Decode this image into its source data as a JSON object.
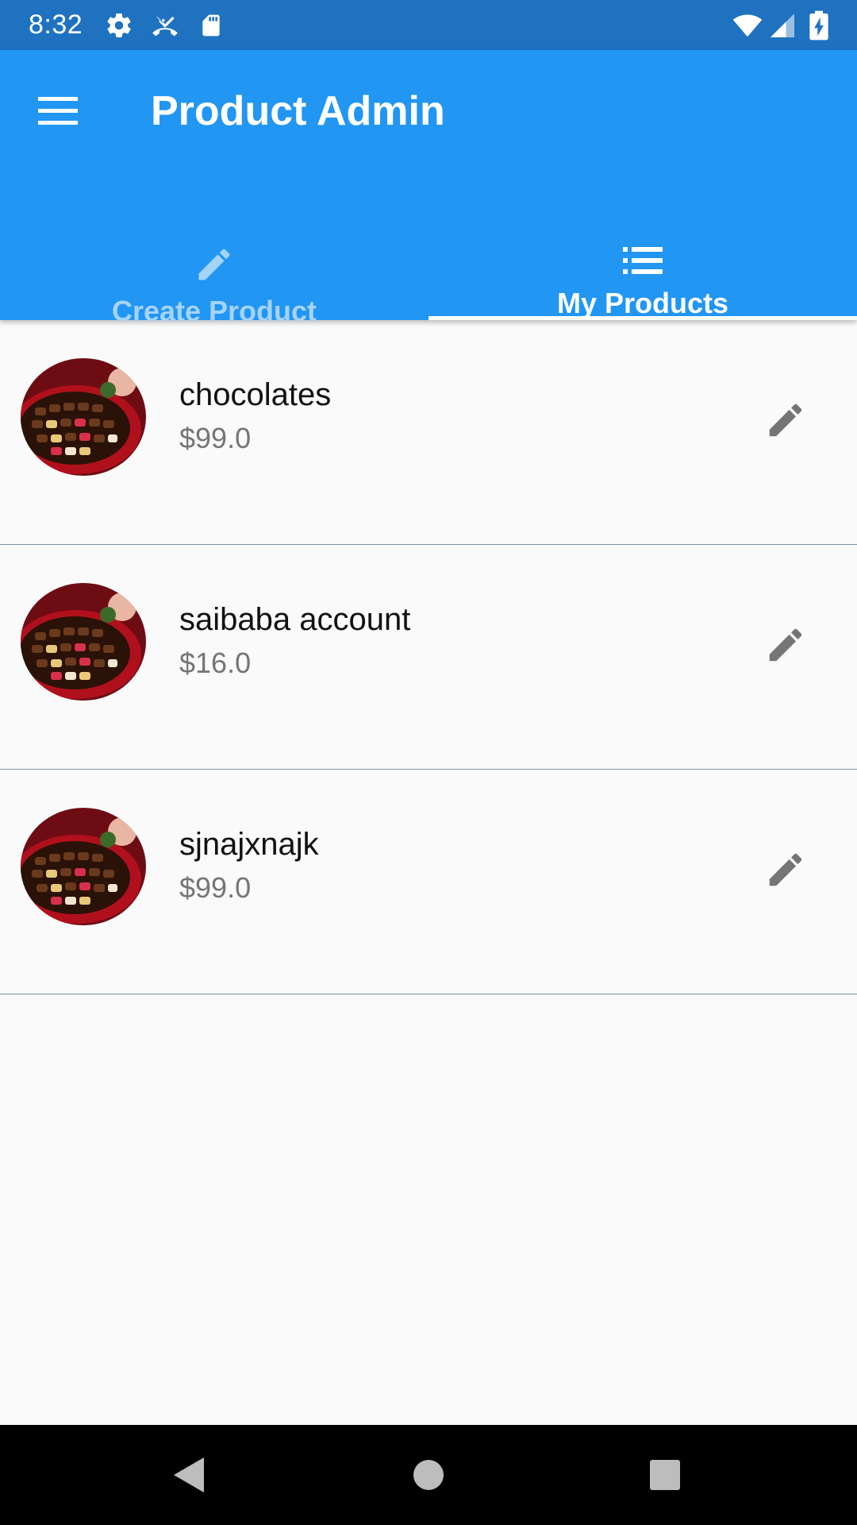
{
  "status_bar": {
    "time": "8:32",
    "icons_left": [
      "gear-icon",
      "call-missed-icon",
      "sd-card-icon"
    ],
    "icons_right": [
      "wifi-icon",
      "signal-icon",
      "battery-charging-icon"
    ]
  },
  "app_bar": {
    "title": "Product Admin",
    "menu_icon": "menu-icon",
    "color": "#2196f3"
  },
  "tabs": [
    {
      "label": "Create Product",
      "icon": "pencil-icon",
      "selected": false
    },
    {
      "label": "My Products",
      "icon": "list-icon",
      "selected": true
    }
  ],
  "products": [
    {
      "title": "chocolates",
      "price": "$99.0",
      "image": "chocolate-box-image"
    },
    {
      "title": "saibaba account",
      "price": "$16.0",
      "image": "chocolate-box-image"
    },
    {
      "title": "sjnajxnajk",
      "price": "$99.0",
      "image": "chocolate-box-image"
    }
  ],
  "nav_bar": {
    "buttons": [
      "back-icon",
      "home-icon",
      "recents-icon"
    ]
  }
}
